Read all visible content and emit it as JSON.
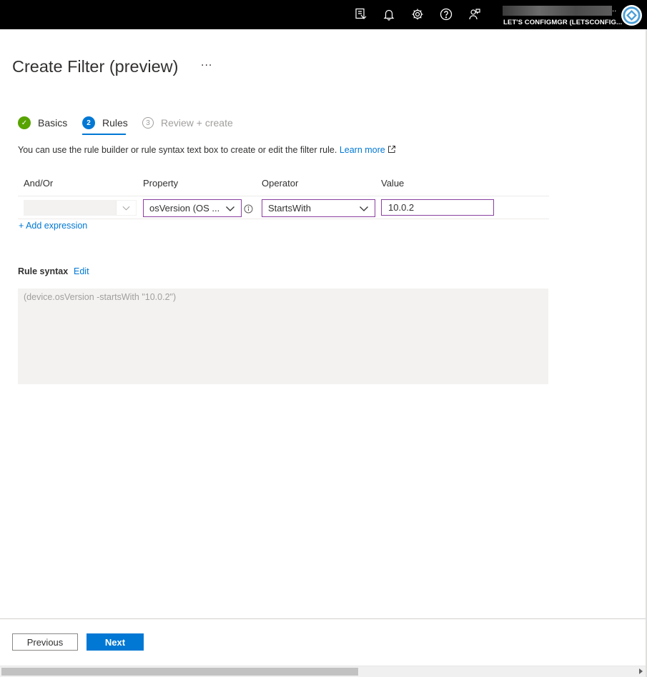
{
  "topbar": {
    "icons": [
      "filter-feedback-icon",
      "bell-icon",
      "gear-icon",
      "help-icon",
      "feedback-icon"
    ],
    "account_dot": "..",
    "tenant": "LET'S CONFIGMGR (LETSCONFIG..."
  },
  "page": {
    "title": "Create Filter (preview)",
    "more": "···"
  },
  "wizard": {
    "steps": [
      {
        "label": "Basics",
        "state": "complete",
        "marker": "✓"
      },
      {
        "label": "Rules",
        "state": "current",
        "marker": "2"
      },
      {
        "label": "Review + create",
        "state": "disabled",
        "marker": "3"
      }
    ]
  },
  "description": {
    "text": "You can use the rule builder or rule syntax text box to create or edit the filter rule.",
    "link": "Learn more"
  },
  "rule_builder": {
    "headers": {
      "andor": "And/Or",
      "property": "Property",
      "operator": "Operator",
      "value": "Value"
    },
    "rows": [
      {
        "andor": "",
        "property": "osVersion (OS ...",
        "operator": "StartsWith",
        "value": "10.0.2"
      }
    ],
    "add_expression": "+ Add expression"
  },
  "rule_syntax": {
    "label": "Rule syntax",
    "edit": "Edit",
    "text": "(device.osVersion -startsWith \"10.0.2\")"
  },
  "footer": {
    "previous": "Previous",
    "next": "Next"
  },
  "colors": {
    "accent": "#0078d4",
    "success": "#57a300",
    "focus_border": "#8a3fa0"
  }
}
